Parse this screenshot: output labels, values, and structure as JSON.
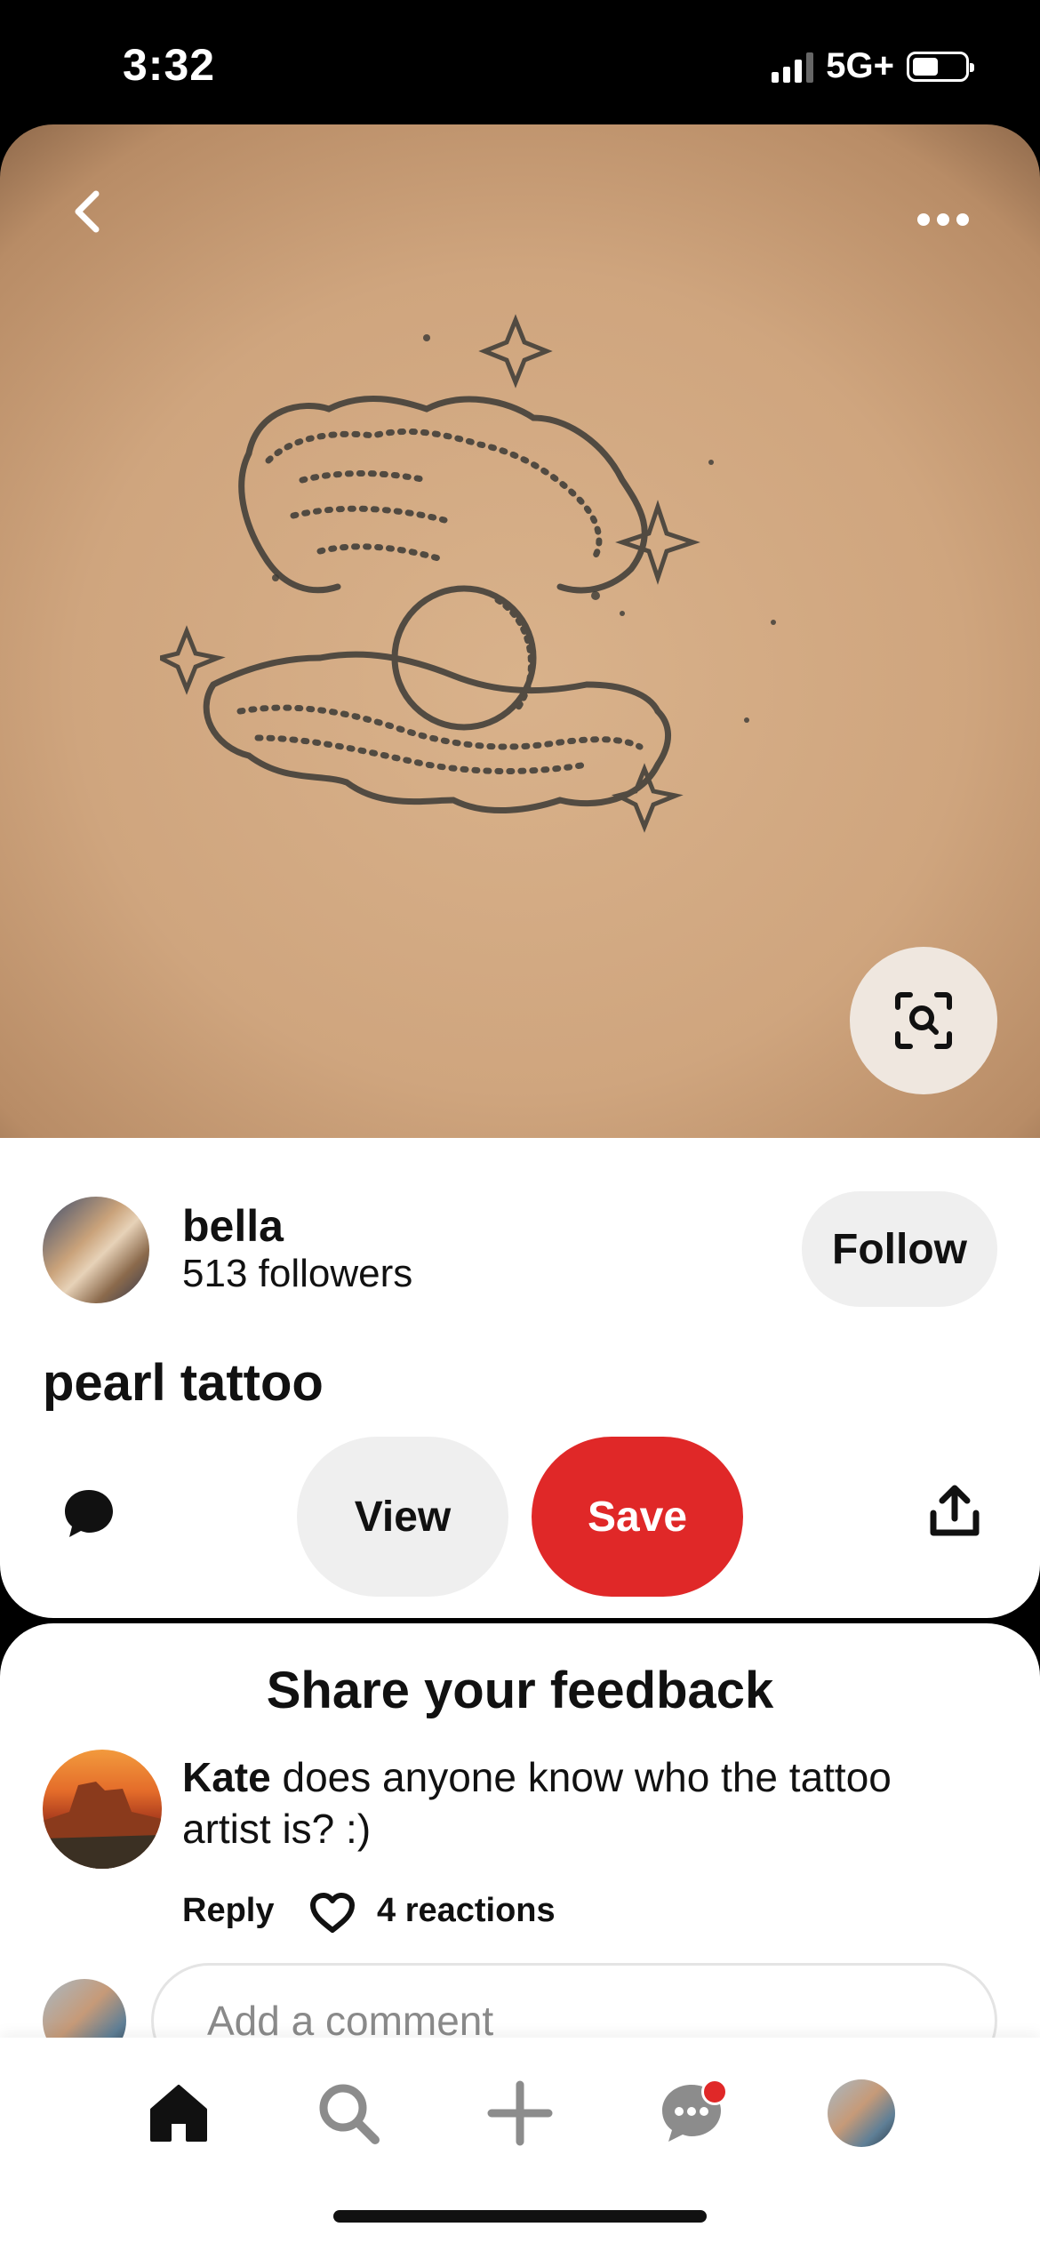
{
  "status_bar": {
    "time": "3:32",
    "network": "5G+",
    "signal_icon": "signal-bars-icon",
    "battery_icon": "battery-icon"
  },
  "pin": {
    "title": "pearl tattoo",
    "image_description_icon": "pearl-shell-tattoo-image",
    "back_icon": "chevron-left-icon",
    "more_icon": "ellipsis-icon",
    "visual_search_icon": "visual-search-icon"
  },
  "creator": {
    "name": "bella",
    "followers": "513 followers",
    "follow_label": "Follow"
  },
  "actions": {
    "comment_icon": "speech-bubble-icon",
    "view_label": "View",
    "save_label": "Save",
    "share_icon": "share-icon",
    "save_color": "#e02828"
  },
  "feedback": {
    "title": "Share your feedback",
    "comments": [
      {
        "author": "Kate",
        "text": "does anyone know who the tattoo artist is? :)",
        "reply_label": "Reply",
        "reactions": "4 reactions"
      }
    ],
    "input_placeholder": "Add a comment"
  },
  "bottom_nav": {
    "items": [
      "home-icon",
      "search-icon",
      "plus-icon",
      "messages-icon",
      "profile-avatar"
    ],
    "has_unread_messages": true
  }
}
